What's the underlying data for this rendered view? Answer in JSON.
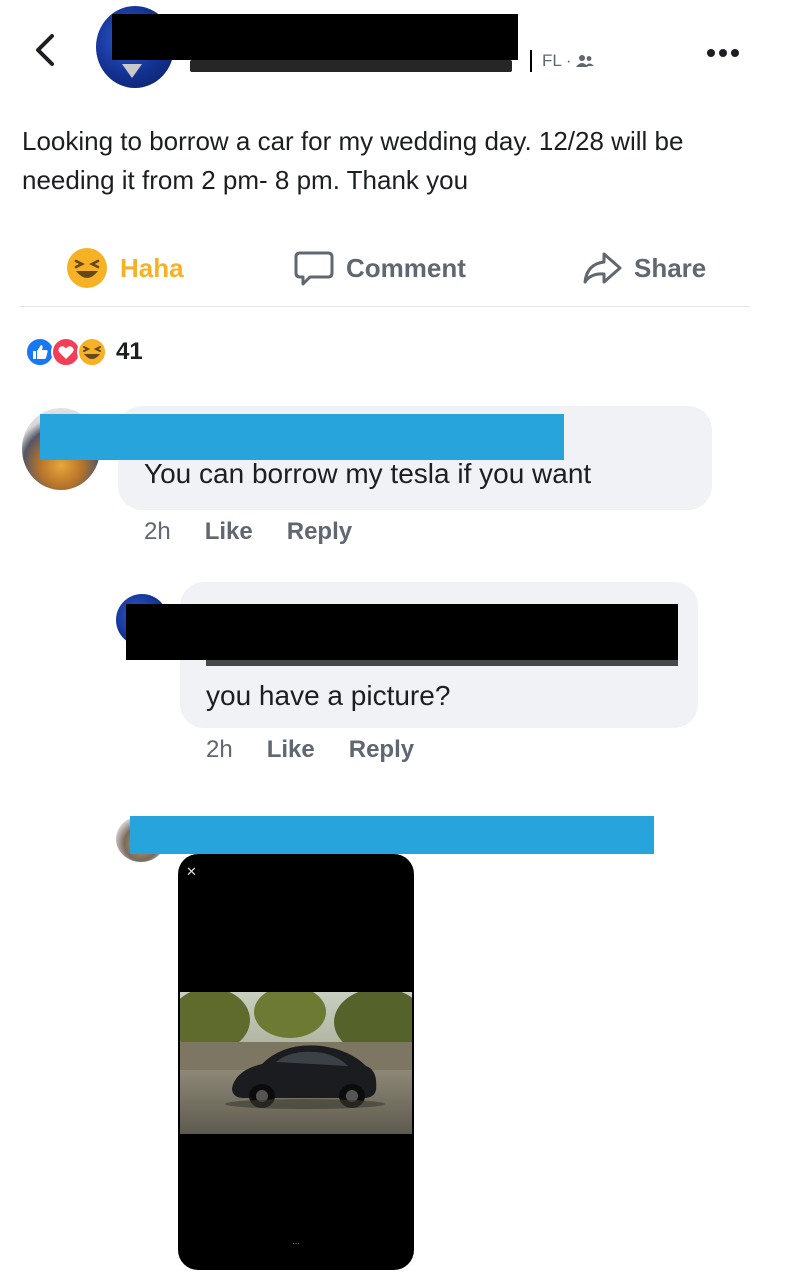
{
  "post": {
    "location": "FL ·",
    "text": "Looking to borrow a car for my wedding day. 12/28 will be needing it from 2 pm- 8 pm. Thank you"
  },
  "actions": {
    "haha": "Haha",
    "comment": "Comment",
    "share": "Share"
  },
  "reactions": {
    "count": "41"
  },
  "comments": [
    {
      "text": "You can borrow my tesla if you want",
      "time": "2h",
      "like": "Like",
      "reply": "Reply"
    },
    {
      "text": "you have a picture?",
      "time": "2h",
      "like": "Like",
      "reply": "Reply"
    }
  ],
  "colors": {
    "haha": "#f7b125",
    "redact_blue": "#27a4dc",
    "like_blue": "#1877f2",
    "love_red": "#f33e58"
  },
  "icons": [
    "back-chevron-icon",
    "friends-icon",
    "more-icon",
    "haha-icon",
    "comment-icon",
    "share-icon",
    "like-reaction-icon",
    "love-reaction-icon",
    "haha-reaction-icon",
    "close-icon"
  ]
}
